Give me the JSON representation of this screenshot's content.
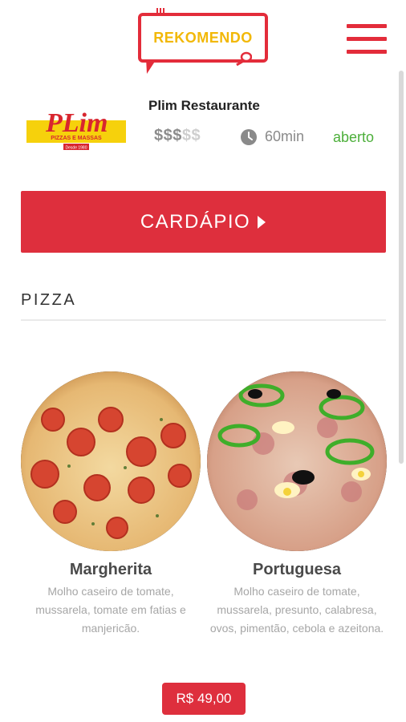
{
  "header": {
    "logo_text": "REKOMENDO",
    "menu_icon": "hamburger-menu-icon"
  },
  "restaurant": {
    "name": "Plim Restaurante",
    "logo": {
      "brand": "PLim",
      "tagline": "PIZZAS E MASSAS",
      "since": "Desde 1980"
    },
    "price_level": {
      "active": "$$$",
      "inactive": "$$"
    },
    "delivery_time": "60min",
    "status": "aberto",
    "status_color": "#4caf3a"
  },
  "cardapio": {
    "label": "CARDÁPIO",
    "icon": "play-arrow-icon"
  },
  "section": {
    "title": "PIZZA"
  },
  "items": [
    {
      "name": "Margherita",
      "description": "Molho caseiro de tomate, mussarela, tomate em fatias e manjericão."
    },
    {
      "name": "Portuguesa",
      "description": "Molho caseiro de tomate, mussarela, presunto, calabresa, ovos, pimentão, cebola e azeitona."
    }
  ],
  "price_badge": "R$ 49,00",
  "colors": {
    "brand_red": "#de2f3d",
    "logo_yellow": "#f2b807"
  }
}
